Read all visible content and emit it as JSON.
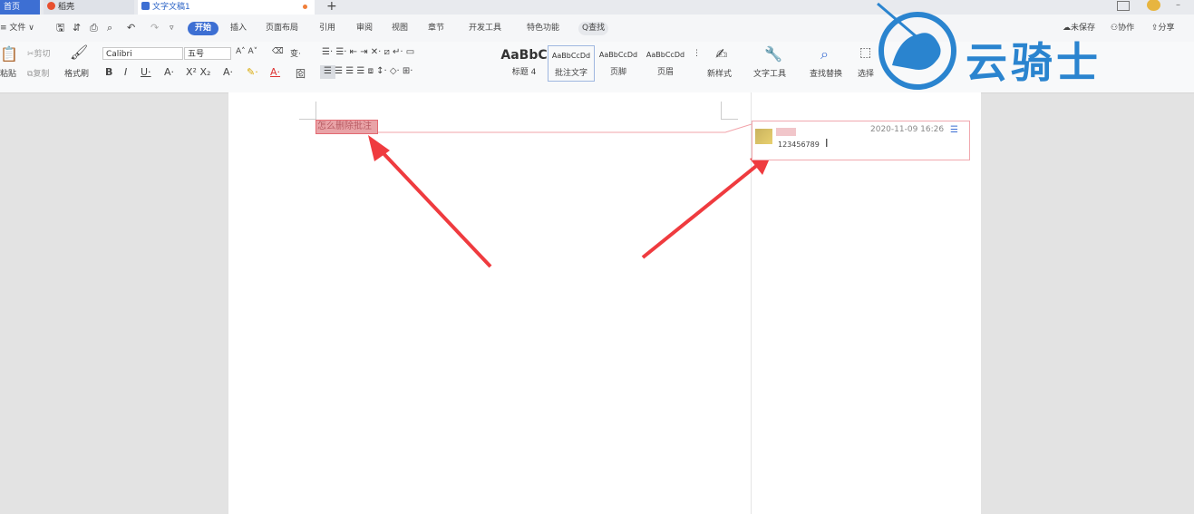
{
  "tabs": {
    "home": "首页",
    "daoke": "稻壳",
    "doc": "文字文稿1",
    "new_tab": "+"
  },
  "menu": {
    "file": "≡ 文件 ∨",
    "items": [
      "开始",
      "插入",
      "页面布局",
      "引用",
      "审阅",
      "视图",
      "章节",
      "开发工具",
      "特色功能"
    ],
    "search": "Q查找",
    "right": [
      "未保存",
      "协作",
      "分享"
    ]
  },
  "toolbar": {
    "paste": "粘贴",
    "cut": "剪切",
    "copy": "复制",
    "format_painter": "格式刷",
    "font_name": "Calibri",
    "font_size": "五号",
    "styles": [
      {
        "sample": "AaBbC",
        "name": "标题 4"
      },
      {
        "sample": "AaBbCcDd",
        "name": "批注文字"
      },
      {
        "sample": "AaBbCcDd",
        "name": "页脚"
      },
      {
        "sample": "AaBbCcDd",
        "name": "页眉"
      }
    ],
    "new_style": "新样式",
    "text_tools": "文字工具",
    "find_replace": "查找替换",
    "select": "选择"
  },
  "document": {
    "highlighted_text": "怎么删除批注"
  },
  "comment": {
    "timestamp": "2020-11-09 16:26",
    "text": "123456789"
  },
  "watermark": {
    "text": "云骑士"
  },
  "colors": {
    "accent": "#3d6fd3",
    "highlight": "#e9a3a7",
    "arrow": "#ef3b3f",
    "watermark": "#2a84cf"
  }
}
